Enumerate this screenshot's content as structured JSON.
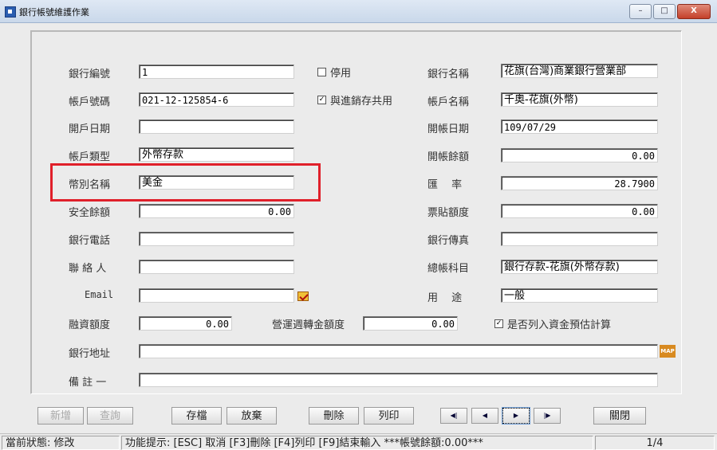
{
  "window": {
    "title": "銀行帳號維護作業",
    "minimize": "–",
    "maximize": "□",
    "close": "X"
  },
  "left": {
    "bank_no": {
      "label": "銀行編號",
      "value": "1"
    },
    "account_no": {
      "label": "帳戶號碼",
      "value": "021-12-125854-6"
    },
    "open_date": {
      "label": "開戶日期",
      "value": ""
    },
    "account_type": {
      "label": "帳戶類型",
      "value": "外幣存款"
    },
    "currency_name": {
      "label": "幣別名稱",
      "value": "美金"
    },
    "safety_balance": {
      "label": "安全餘額",
      "value": "0.00"
    },
    "bank_phone": {
      "label": "銀行電話",
      "value": ""
    },
    "contact": {
      "label": "聯 絡 人",
      "value": ""
    },
    "email": {
      "label": "Email",
      "value": ""
    },
    "financing_limit": {
      "label": "融資額度",
      "value": "0.00"
    },
    "bank_address": {
      "label": "銀行地址",
      "value": ""
    },
    "note1": {
      "label": "備 註 一",
      "value": ""
    }
  },
  "middle": {
    "disabled": {
      "label": "停用",
      "checked": false
    },
    "shared": {
      "label": "與進銷存共用",
      "checked": true
    },
    "turnover_limit": {
      "label": "營運週轉金額度",
      "value": "0.00"
    },
    "fund_forecast": {
      "label": "是否列入資金預估計算",
      "checked": true
    }
  },
  "right": {
    "bank_name": {
      "label": "銀行名稱",
      "value": "花旗(台灣)商業銀行營業部"
    },
    "account_name": {
      "label": "帳戶名稱",
      "value": "千奧-花旗(外幣)"
    },
    "account_open_date": {
      "label": "開帳日期",
      "value": "109/07/29"
    },
    "opening_balance": {
      "label": "開帳餘額",
      "value": "0.00"
    },
    "exchange_rate": {
      "label": "匯　 率",
      "value": "28.7900"
    },
    "bill_limit": {
      "label": "票貼額度",
      "value": "0.00"
    },
    "bank_fax": {
      "label": "銀行傳真",
      "value": ""
    },
    "gl_account": {
      "label": "總帳科目",
      "value": "銀行存款-花旗(外幣存款)"
    },
    "usage": {
      "label": "用　 途",
      "value": "一般"
    }
  },
  "icons": {
    "email": "mail-icon",
    "map_label": "MAP"
  },
  "buttons": {
    "add": "新增",
    "query": "查詢",
    "save": "存檔",
    "discard": "放棄",
    "delete": "刪除",
    "print": "列印",
    "close": "關閉"
  },
  "nav": {
    "first": "◀|",
    "prev": "◀",
    "next": "▶",
    "last": "|▶"
  },
  "status": {
    "state": "當前狀態: 修改",
    "hint": "功能提示: [ESC] 取消 [F3]刪除 [F4]列印 [F9]結束輸入 ***帳號餘額:0.00***",
    "page": "1/4"
  },
  "colors": {
    "highlight": "#e0202a",
    "titlebar": "#c9d8ea"
  }
}
